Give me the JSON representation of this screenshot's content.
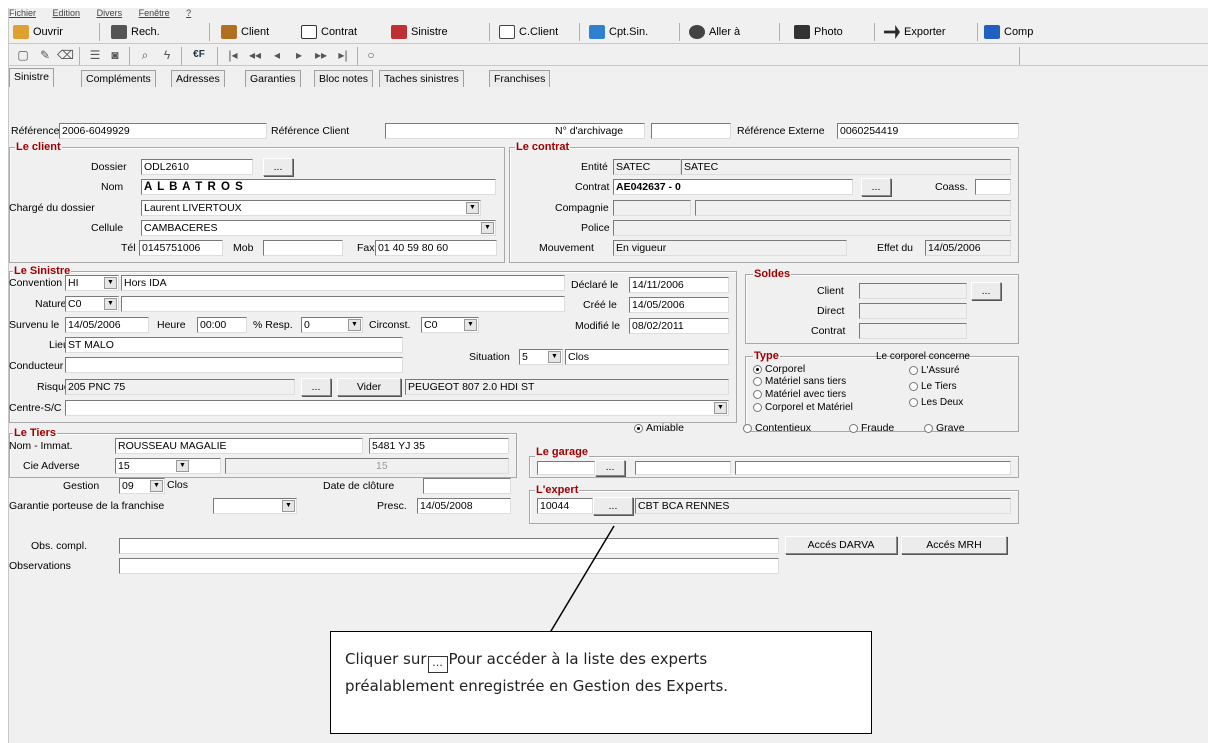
{
  "menu": [
    "Fichier",
    "Edition",
    "Divers",
    "Fenêtre",
    "?"
  ],
  "toolbar": {
    "ouvrir": "Ouvrir",
    "rech": "Rech.",
    "client": "Client",
    "contrat": "Contrat",
    "sinistre": "Sinistre",
    "cclient": "C.Client",
    "cptsin": "Cpt.Sin.",
    "allera": "Aller à",
    "photo": "Photo",
    "exporter": "Exporter",
    "comp": "Comp"
  },
  "toolbar2": {
    "euro": "€F"
  },
  "tabs": [
    "Sinistre",
    "Compléments",
    "Adresses",
    "Garanties",
    "Bloc notes",
    "Taches sinistres",
    "Franchises"
  ],
  "header": {
    "reference_label": "Référence",
    "reference": "2006-6049929",
    "ref_client_label": "Référence Client",
    "ref_client": "",
    "archivage_label": "N° d'archivage",
    "archivage": "",
    "ref_externe_label": "Référence Externe",
    "ref_externe": "0060254419"
  },
  "client": {
    "title": "Le client",
    "dossier_label": "Dossier",
    "dossier": "ODL2610",
    "nom_label": "Nom",
    "nom": "A L B A T R O S",
    "charge_label": "Chargé du dossier",
    "charge": "Laurent LIVERTOUX",
    "cellule_label": "Cellule",
    "cellule": "CAMBACERES",
    "tel_label": "Tél",
    "tel": "0145751006",
    "mob_label": "Mob",
    "mob": "",
    "fax_label": "Fax",
    "fax": "01 40 59 80 60"
  },
  "contrat": {
    "title": "Le contrat",
    "entite_label": "Entité",
    "entite1": "SATEC",
    "entite2": "SATEC",
    "contrat_label": "Contrat",
    "contrat": "AE042637 - 0",
    "coass_label": "Coass.",
    "compagnie_label": "Compagnie",
    "police_label": "Police",
    "mouvement_label": "Mouvement",
    "mouvement": "En vigueur",
    "effet_label": "Effet du",
    "effet": "14/05/2006"
  },
  "sinistre": {
    "title": "Le Sinistre",
    "convention_label": "Convention",
    "convention_code": "HI",
    "convention": "Hors IDA",
    "nature_label": "Nature",
    "nature": "C0",
    "survenu_label": "Survenu le",
    "survenu": "14/05/2006",
    "heure_label": "Heure",
    "heure": "00:00",
    "resp_label": "% Resp.",
    "resp": "0",
    "circonst_label": "Circonst.",
    "circonst": "C0",
    "declare_label": "Déclaré le",
    "declare": "14/11/2006",
    "cree_label": "Créé le",
    "cree": "14/05/2006",
    "modifie_label": "Modifié le",
    "modifie": "08/02/2011",
    "lieu_label": "Lieu",
    "lieu": "ST MALO",
    "situation_label": "Situation",
    "situation_code": "5",
    "situation": "Clos",
    "conducteur_label": "Conducteur",
    "risque_label": "Risque",
    "risque": "205 PNC 75",
    "vider": "Vider",
    "vehicule": "PEUGEOT 807 2.0 HDI ST",
    "centre_label": "Centre-S/C"
  },
  "soldes": {
    "title": "Soldes",
    "client_label": "Client",
    "direct_label": "Direct",
    "contrat_label": "Contrat"
  },
  "type": {
    "title": "Type",
    "options": [
      "Corporel",
      "Matériel sans tiers",
      "Matériel avec tiers",
      "Corporel et Matériel"
    ],
    "concerne_label": "Le corporel concerne",
    "concerne": [
      "L'Assuré",
      "Le Tiers",
      "Les Deux"
    ]
  },
  "reglement": [
    "Amiable",
    "Contentieux",
    "Fraude",
    "Grave"
  ],
  "tiers": {
    "title": "Le Tiers",
    "nom_label": "Nom - Immat.",
    "nom": "ROUSSEAU MAGALIE",
    "immat": "5481 YJ 35",
    "cie_label": "Cie Adverse",
    "cie": "15",
    "cie_ro": "15"
  },
  "gestion": {
    "gestion_label": "Gestion",
    "gestion_code": "09",
    "gestion": "Clos",
    "cloture_label": "Date de clôture",
    "franchise_label": "Garantie porteuse de la franchise",
    "presc_label": "Presc.",
    "presc": "14/05/2008"
  },
  "garage": {
    "title": "Le garage"
  },
  "expert": {
    "title": "L'expert",
    "code": "10044",
    "name": "CBT BCA RENNES"
  },
  "obs": {
    "compl_label": "Obs. compl.",
    "obs_label": "Observations"
  },
  "buttons": {
    "darva": "Accés DARVA",
    "mrh": "Accés MRH",
    "ellipsis": "..."
  },
  "callout": {
    "line1a": "Cliquer sur",
    "line1b": "Pour accéder à la liste des experts",
    "line2": "préalablement enregistrée en Gestion des Experts."
  }
}
